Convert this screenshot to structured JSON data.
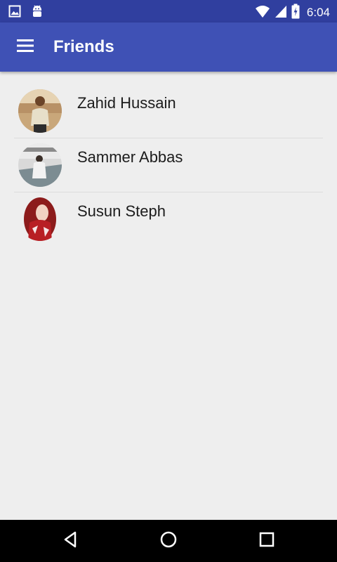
{
  "status_bar": {
    "time": "6:04",
    "left_icons": [
      "image-notification-icon",
      "android-debug-icon"
    ],
    "right_icons": [
      "wifi-icon",
      "cell-signal-icon",
      "battery-charging-icon"
    ]
  },
  "app_bar": {
    "title": "Friends",
    "menu_icon": "hamburger-menu-icon"
  },
  "friends": [
    {
      "name": "Zahid Hussain",
      "avatar": "avatar-photo"
    },
    {
      "name": "Sammer Abbas",
      "avatar": "avatar-photo"
    },
    {
      "name": "Susun Steph",
      "avatar": "avatar-photo"
    }
  ],
  "nav_bar": {
    "buttons": [
      "back-icon",
      "home-icon",
      "recents-icon"
    ]
  },
  "colors": {
    "status_bar": "#303f9f",
    "app_bar": "#3f51b5",
    "background": "#eeeeee",
    "nav_bar": "#000000"
  }
}
